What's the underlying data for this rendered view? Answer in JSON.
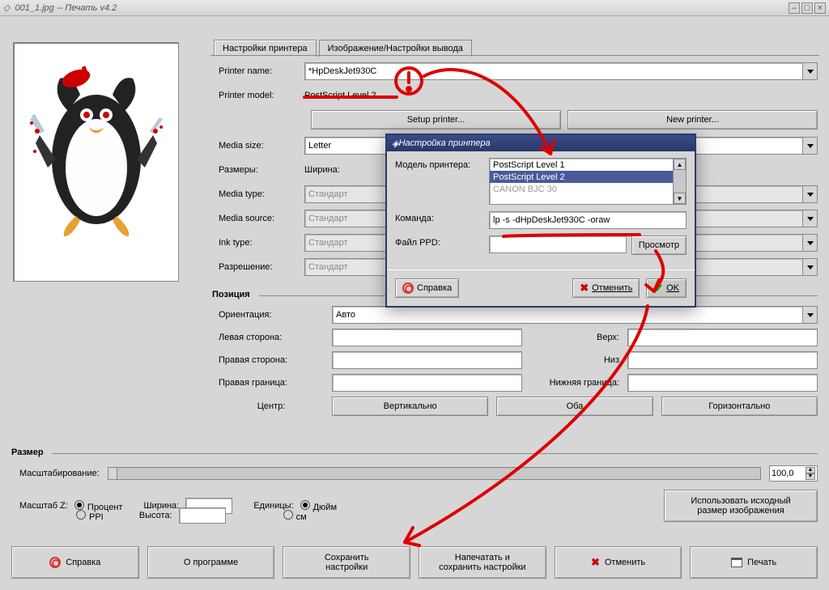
{
  "window": {
    "title": "001_1.jpg -- Печать v4.2",
    "diamond_icon": "◇"
  },
  "tabs": {
    "printer": "Настройки принтера",
    "output": "Изображение/Настройки вывода"
  },
  "printer": {
    "name_lbl": "Printer name:",
    "name_val": "*HpDeskJet930C",
    "model_lbl": "Printer model:",
    "model_val": "PostScript Level 2",
    "setup_btn": "Setup printer...",
    "new_btn": "New printer...",
    "media_size_lbl": "Media size:",
    "media_size_val": "Letter",
    "dims_lbl": "Размеры:",
    "width_lbl": "Ширина:",
    "media_type_lbl": "Media type:",
    "media_type_val": "Стандарт",
    "media_source_lbl": "Media source:",
    "media_source_val": "Стандарт",
    "ink_type_lbl": "Ink type:",
    "ink_type_val": "Стандарт",
    "resolution_lbl": "Разрешение:",
    "resolution_val": "Стандарт"
  },
  "position": {
    "section": "Позиция",
    "orientation_lbl": "Ориентация:",
    "orientation_val": "Авто",
    "left_lbl": "Левая сторона:",
    "top_lbl": "Верх:",
    "right_lbl": "Правая сторона:",
    "bottom_lbl": "Низ",
    "right_border_lbl": "Правая граница:",
    "bottom_border_lbl": "Нижняя граница:",
    "center_lbl": "Центр:",
    "vert_btn": "Вертикально",
    "both_btn": "Оба",
    "horiz_btn": "Горизонтально"
  },
  "size": {
    "section": "Размер",
    "scaling_lbl": "Масштабирование:",
    "scaling_val": "100,0",
    "scale_z_lbl": "Масштаб Z:",
    "percent": "Процент",
    "ppi": "PPI",
    "width_lbl": "Ширина:",
    "height_lbl": "Высота:",
    "units_lbl": "Единицы:",
    "inch": "Дюйм",
    "cm": "см",
    "use_orig_btn": "Использовать исходный\nразмер изображения"
  },
  "buttons": {
    "help": "Справка",
    "about": "О программе",
    "save": "Сохранить\nнастройки",
    "print_save": "Напечатать и\nсохранить настройки",
    "cancel": "Отменить",
    "print": "Печать"
  },
  "modal": {
    "title": "Настройка принтера",
    "model_lbl": "Модель принтера:",
    "items": [
      "PostScript Level 1",
      "PostScript Level 2",
      "CANON BJC 30"
    ],
    "selected_idx": 1,
    "command_lbl": "Команда:",
    "command_val": "lp -s -dHpDeskJet930C -oraw",
    "ppd_lbl": "Файл PPD:",
    "browse_btn": "Просмотр",
    "help_btn": "Справка",
    "cancel_btn": "Отменить",
    "ok_btn": "OK"
  }
}
